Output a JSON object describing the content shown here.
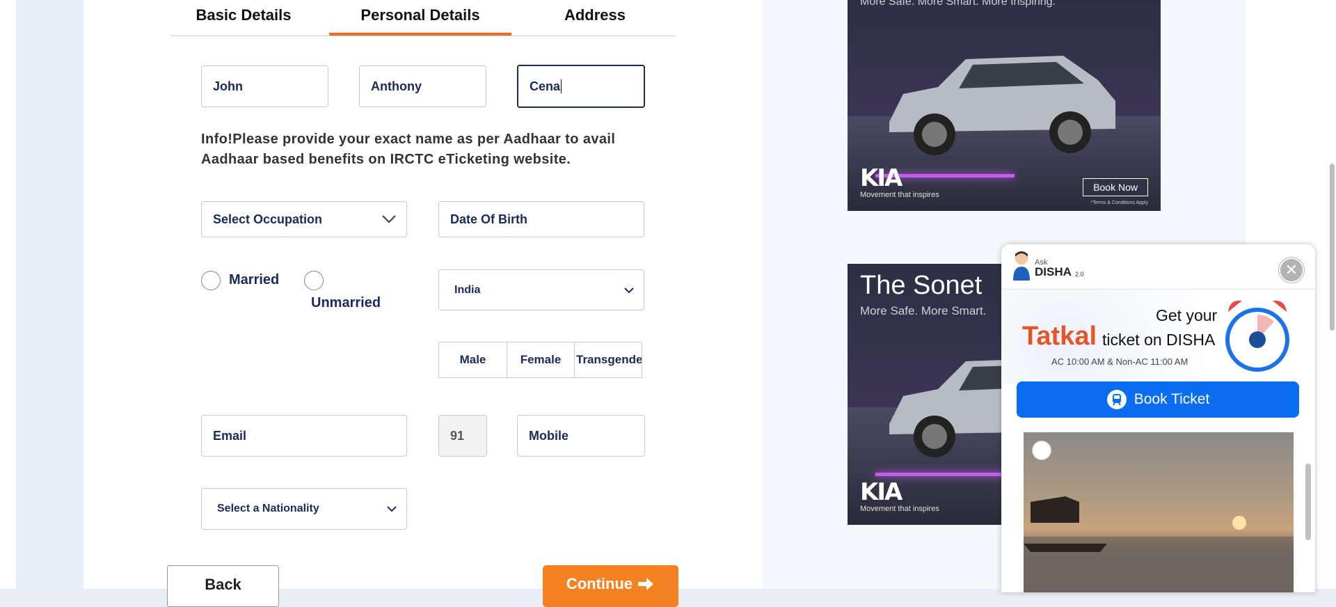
{
  "tabs": [
    "Basic Details",
    "Personal Details",
    "Address"
  ],
  "name": {
    "first": "John",
    "middle": "Anthony",
    "last": "Cena"
  },
  "info_text": "Info!Please provide your exact name as per Aadhaar to avail Aadhaar based benefits on IRCTC eTicketing website.",
  "occupation": {
    "placeholder": "Select Occupation"
  },
  "dob": {
    "placeholder": "Date Of Birth"
  },
  "marital": {
    "married": "Married",
    "unmarried": "Unmarried"
  },
  "country": {
    "selected": "India"
  },
  "gender": [
    "Male",
    "Female",
    "Transgender"
  ],
  "contact": {
    "email_placeholder": "Email",
    "country_code": "91",
    "mobile_placeholder": "Mobile"
  },
  "nationality": {
    "placeholder": "Select a Nationality"
  },
  "buttons": {
    "back": "Back",
    "continue": "Continue"
  },
  "ads": {
    "ad1": {
      "headline": "More Safe. More Smart. More Inspiring.",
      "logo": "KIA",
      "tagline": "Movement that inspires",
      "cta": "Book Now",
      "fineprint": "*Terms & Conditions Apply"
    },
    "ad2": {
      "title": "The Sonet",
      "headline": "More Safe. More Smart.",
      "logo": "KIA",
      "tagline": "Movement that inspires"
    }
  },
  "disha": {
    "ask": "Ask",
    "name": "DISHA",
    "version": "2.0",
    "promo_get": "Get your",
    "promo_tatkal": "Tatkal",
    "promo_rest": "ticket on DISHA",
    "promo_times": "AC 10:00 AM & Non-AC 11:00 AM",
    "book_label": "Book Ticket"
  },
  "colors": {
    "accent": "#f26a21",
    "navy": "#1a2a5e",
    "disha_blue": "#0a6cf0"
  },
  "icons": [
    "chevron-down-icon",
    "close-icon",
    "train-icon",
    "arrow-right-icon",
    "alarm-clock-icon",
    "disha-avatar-icon",
    "irctc-logo-icon"
  ]
}
